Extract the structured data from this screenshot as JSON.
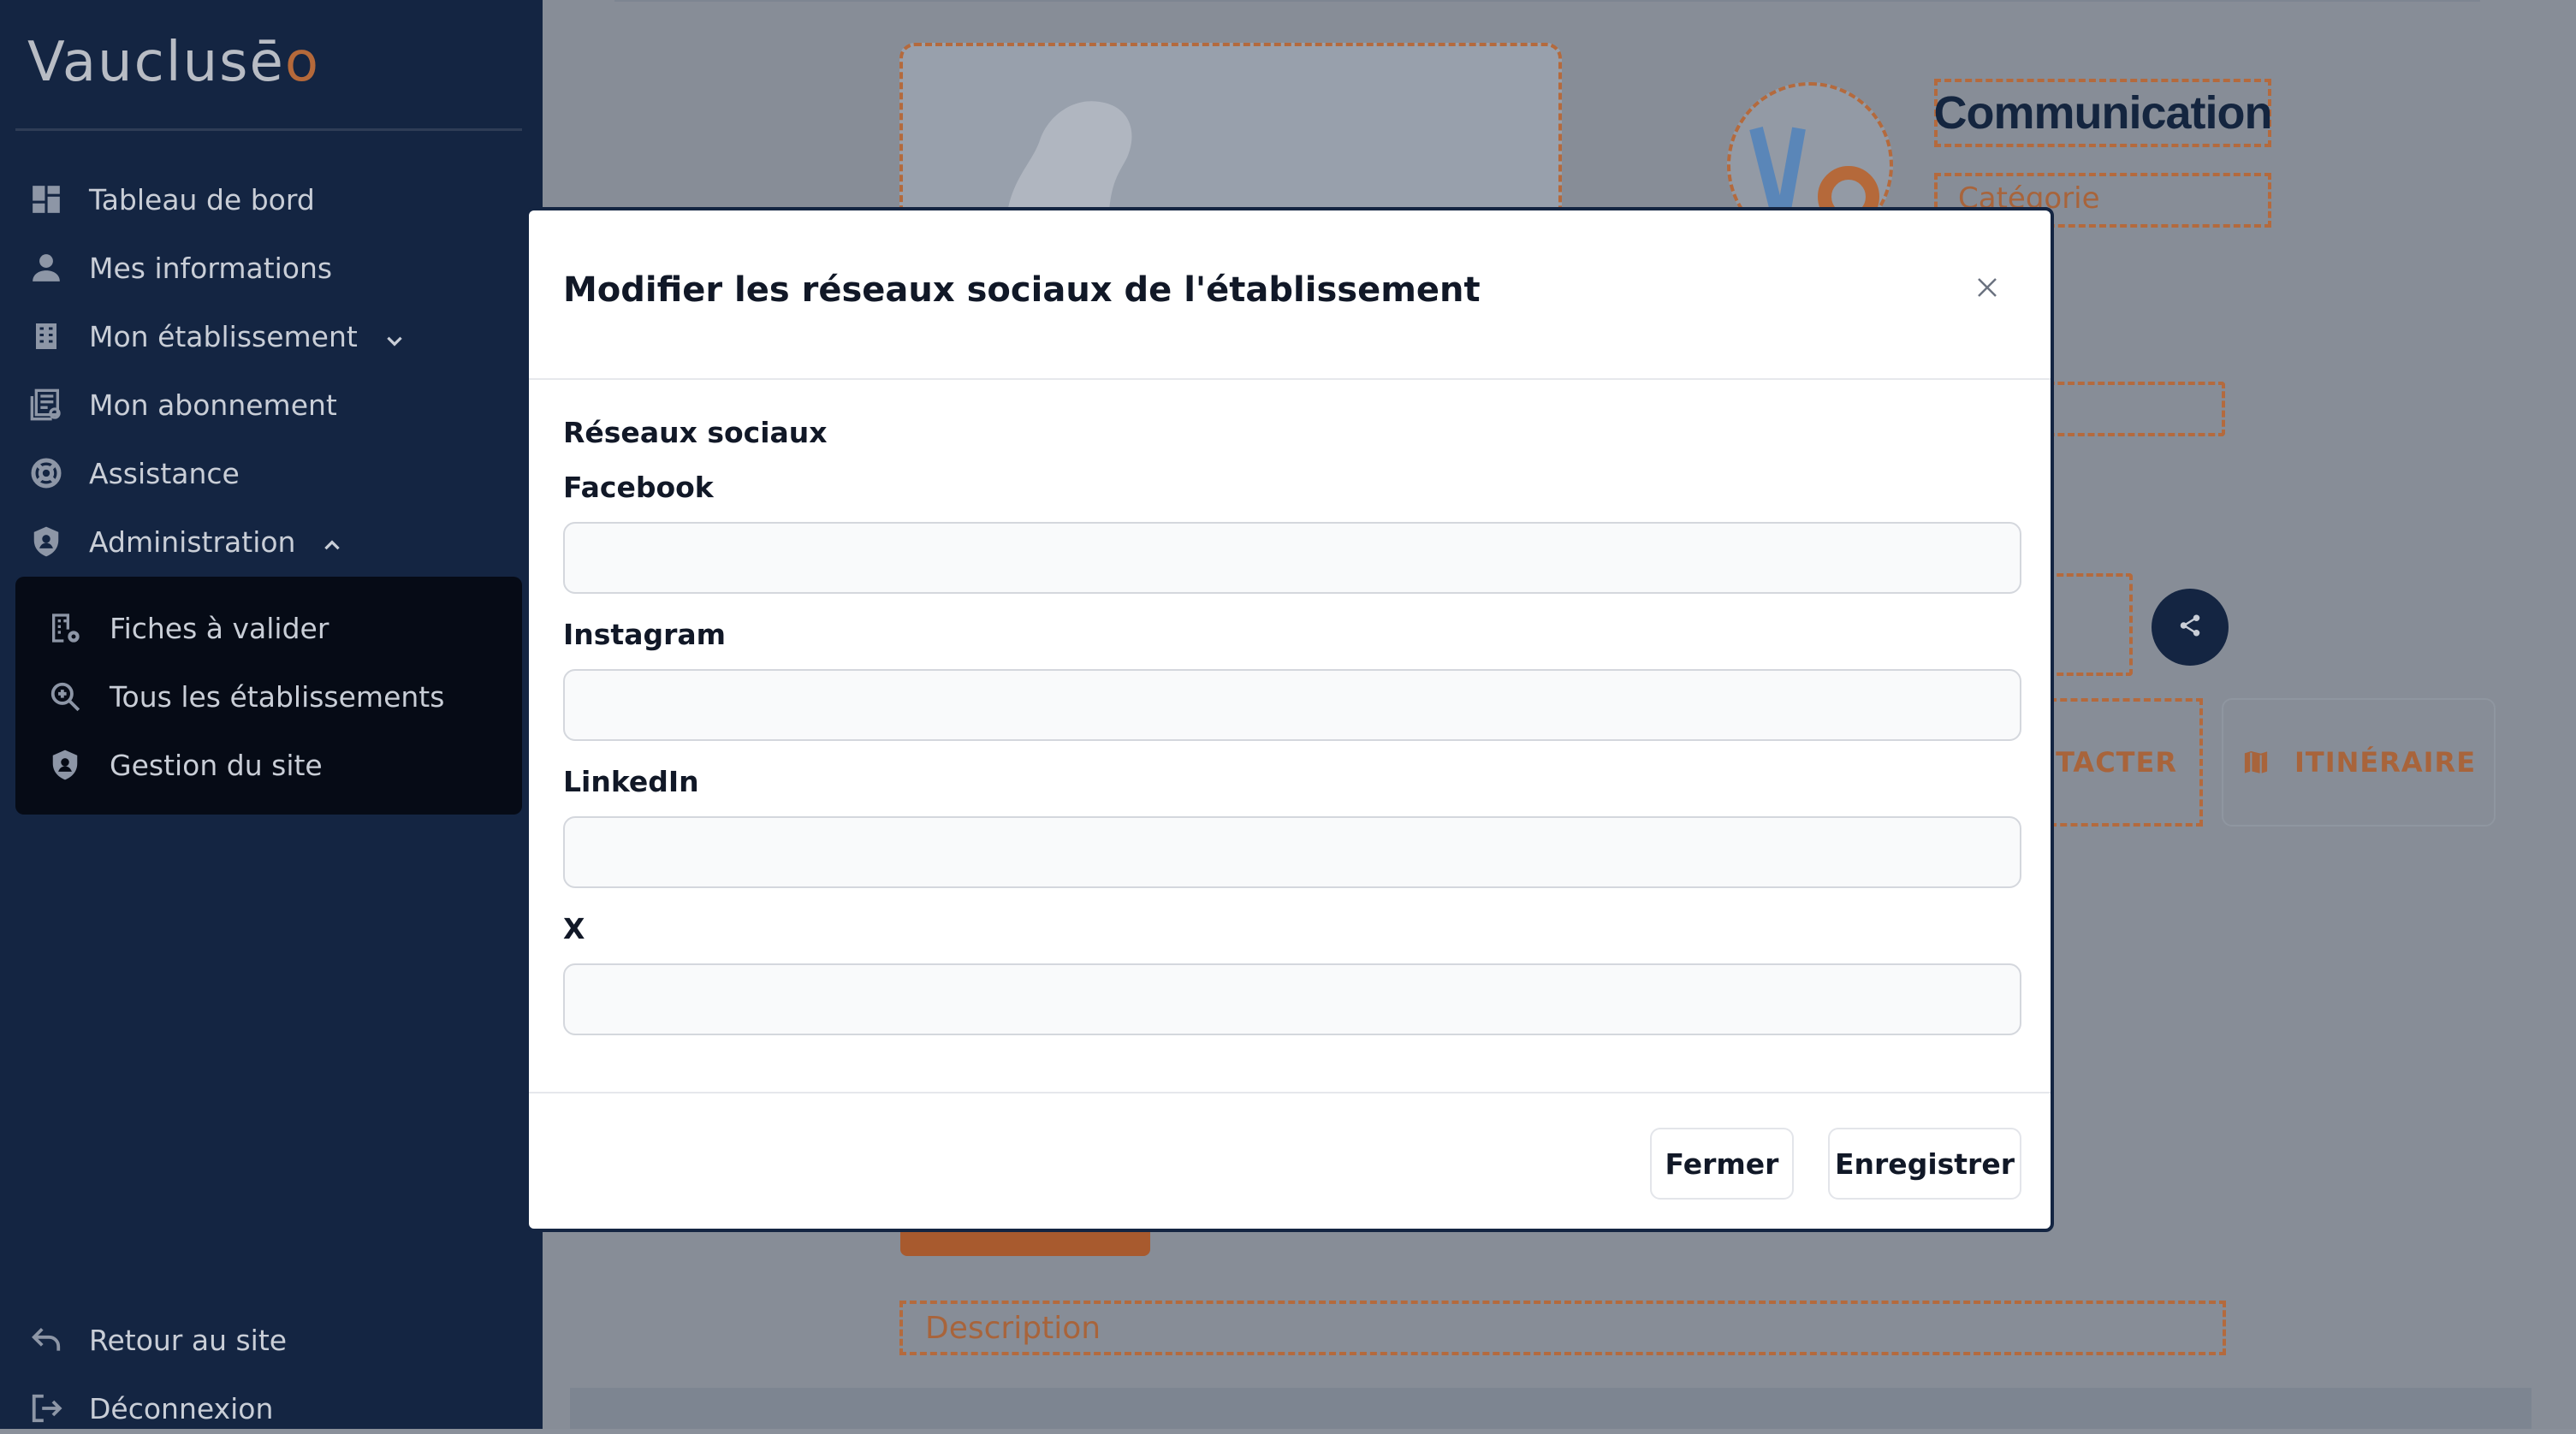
{
  "brand": {
    "logo_text": "Vauclusē",
    "logo_accent": "o"
  },
  "sidebar": {
    "items": [
      {
        "label": "Tableau de bord",
        "icon": "dashboard-icon"
      },
      {
        "label": "Mes informations",
        "icon": "user-icon"
      },
      {
        "label": "Mon établissement",
        "icon": "building-icon"
      },
      {
        "label": "Mon abonnement",
        "icon": "subscription-icon"
      },
      {
        "label": "Assistance",
        "icon": "lifebuoy-icon"
      },
      {
        "label": "Administration",
        "icon": "shield-icon"
      }
    ],
    "admin_submenu": [
      {
        "label": "Fiches à valider",
        "icon": "building-gear-icon"
      },
      {
        "label": "Tous les établissements",
        "icon": "search-icon"
      },
      {
        "label": "Gestion du site",
        "icon": "shield-icon"
      }
    ],
    "footer_items": [
      {
        "label": "Retour au site",
        "icon": "back-arrow-icon"
      },
      {
        "label": "Déconnexion",
        "icon": "logout-icon"
      }
    ]
  },
  "background": {
    "title": "Communication",
    "category": "Catégorie",
    "contact_label": "NTACTER",
    "itinerary_label": "ITINÉRAIRE",
    "description_placeholder": "Description"
  },
  "modal": {
    "title": "Modifier les réseaux sociaux de l'établissement",
    "section_label": "Réseaux sociaux",
    "fields": [
      {
        "label": "Facebook",
        "value": ""
      },
      {
        "label": "Instagram",
        "value": ""
      },
      {
        "label": "LinkedIn",
        "value": ""
      },
      {
        "label": "X",
        "value": ""
      }
    ],
    "close_label": "Fermer",
    "save_label": "Enregistrer"
  },
  "colors": {
    "sidebar_bg": "#142542",
    "accent_orange": "#b46a3d",
    "overlay_bg": "#878d97"
  }
}
